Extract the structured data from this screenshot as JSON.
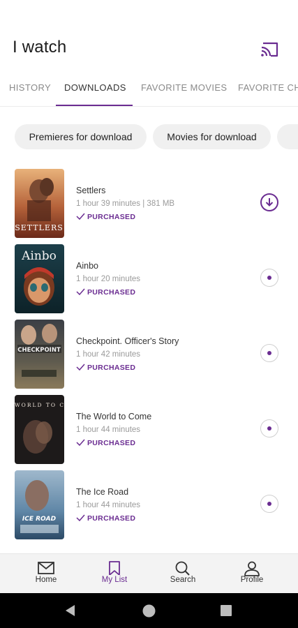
{
  "header": {
    "title": "I watch",
    "cast_icon": "cast-icon",
    "accent": "#6a2c91"
  },
  "tabs": [
    {
      "label": "HISTORY",
      "active": false
    },
    {
      "label": "DOWNLOADS",
      "active": true
    },
    {
      "label": "FAVORITE MOVIES",
      "active": false
    },
    {
      "label": "FAVORITE CHA",
      "active": false
    }
  ],
  "chips": [
    {
      "label": "Premieres for download"
    },
    {
      "label": "Movies for download"
    }
  ],
  "downloads": [
    {
      "title": "Settlers",
      "meta": "1 hour 39 minutes | 381 MB",
      "status": "PURCHASED",
      "poster_text": "SETTLERS",
      "action": "download"
    },
    {
      "title": "Ainbo",
      "meta": "1 hour 20 minutes",
      "status": "PURCHASED",
      "poster_text": "Ainbo",
      "action": "queued"
    },
    {
      "title": "Checkpoint. Officer's Story",
      "meta": "1 hour 42 minutes",
      "status": "PURCHASED",
      "poster_text": "CHECKPOINT",
      "action": "queued"
    },
    {
      "title": "The World to Come",
      "meta": "1 hour 44 minutes",
      "status": "PURCHASED",
      "poster_text": "THE WORLD TO COME",
      "action": "queued"
    },
    {
      "title": "The Ice Road",
      "meta": "1 hour 44 minutes",
      "status": "PURCHASED",
      "poster_text": "ICE ROAD",
      "action": "queued"
    }
  ],
  "bottom_nav": [
    {
      "label": "Home",
      "icon": "home-icon",
      "active": false
    },
    {
      "label": "My List",
      "icon": "bookmark-icon",
      "active": true
    },
    {
      "label": "Search",
      "icon": "search-icon",
      "active": false
    },
    {
      "label": "Profile",
      "icon": "profile-icon",
      "active": false
    }
  ],
  "system_nav": {
    "back": "back-icon",
    "home": "home-circle-icon",
    "recents": "recents-icon"
  }
}
